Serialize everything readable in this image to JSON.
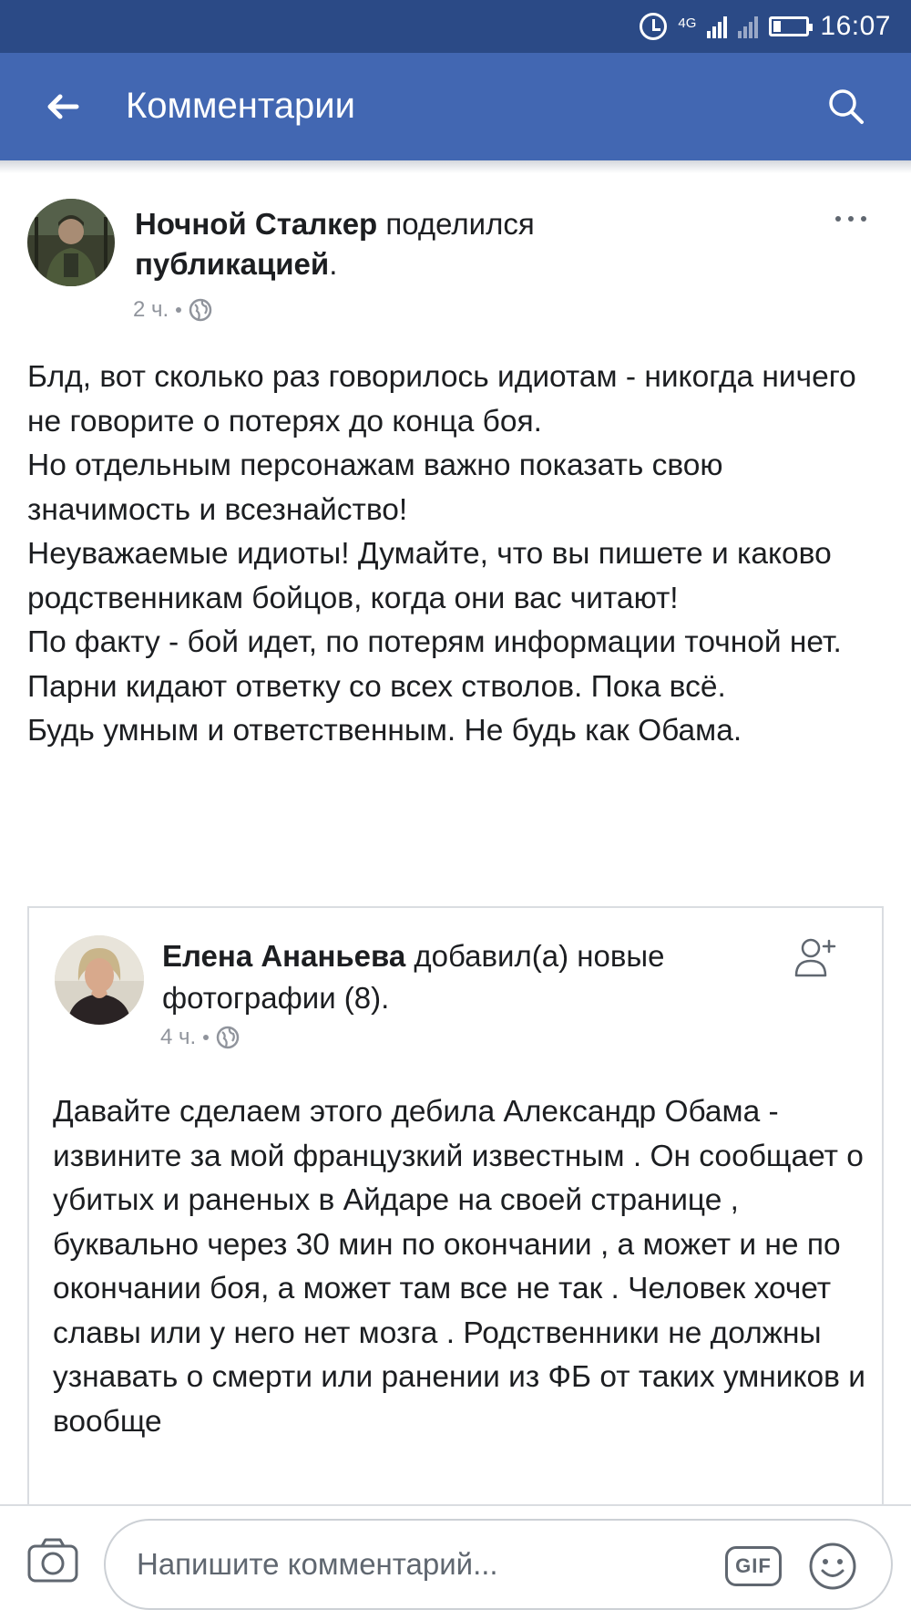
{
  "status_bar": {
    "network": "4G",
    "time": "16:07"
  },
  "header": {
    "title": "Комментарии"
  },
  "post": {
    "author": "Ночной Сталкер",
    "action": "поделился",
    "object": "публикацией",
    "time": "2 ч.",
    "paragraphs": [
      "Блд, вот сколько раз говорилось идиотам - никогда ничего не говорите о потерях до конца боя.",
      "Но отдельным персонажам важно показать свою значимость и всезнайство!",
      "Неуважаемые идиоты! Думайте, что вы пишете и каково родственникам бойцов, когда они вас читают!",
      "По факту - бой идет, по потерям информации точной нет.",
      "Парни кидают ответку со всех стволов. Пока всё.",
      "Будь умным и ответственным. Не будь как Обама."
    ]
  },
  "shared_post": {
    "author": "Елена Ананьева",
    "action": "добавил(а) новые фотографии (8).",
    "time": "4 ч.",
    "body": "Давайте сделаем этого дебила Александр Обама - извините за мой французкий известным . Он сообщает о убитых и раненых в Айдаре  на своей странице  , буквально через 30 мин по окончании , а может и не по окончании боя, а может там  все не так . Человек хочет славы или у него нет мозга . Родственники не должны узнавать о смерти или ранении из ФБ от таких умников и вообще"
  },
  "composer": {
    "placeholder": "Напишите комментарий...",
    "gif_label": "GIF"
  },
  "icons": {
    "back": "arrow-left-icon",
    "search": "search-icon",
    "more": "more-horizontal-icon",
    "privacy": "globe-icon",
    "add_friend": "add-friend-icon",
    "camera": "camera-icon",
    "emoji": "emoji-icon"
  },
  "colors": {
    "header_bg": "#4267b2",
    "status_bar_bg": "#2b4a86",
    "meta_text": "#90949c"
  }
}
